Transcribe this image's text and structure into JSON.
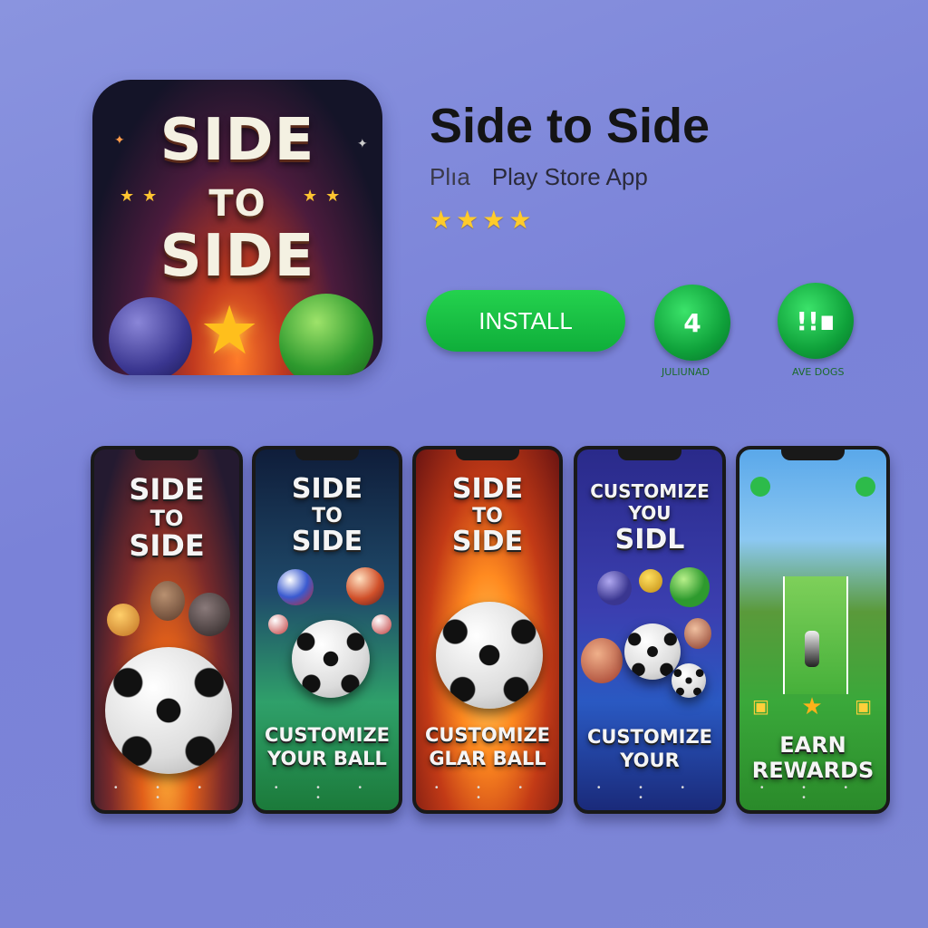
{
  "app": {
    "name": "Side to Side",
    "store_prefix": "Plıa",
    "store_label": "Play Store App",
    "rating_stars": 4,
    "install_label": "INSTALL",
    "badges": [
      {
        "label": "JULIUNAD"
      },
      {
        "label": "AVE DOGS"
      }
    ]
  },
  "icon": {
    "title_line1": "SIDE",
    "title_line2": "TO",
    "title_line3": "SIDE"
  },
  "screenshots": [
    {
      "top": [
        "SIDE",
        "TO",
        "SIDE"
      ],
      "bottom": []
    },
    {
      "top": [
        "SIDE",
        "TO",
        "SIDE"
      ],
      "bottom": [
        "CUSTOMIZE",
        "YOUR BALL"
      ]
    },
    {
      "top": [
        "SIDE",
        "TO",
        "SIDE"
      ],
      "bottom": [
        "CUSTOMIZE",
        "GLAR BALL"
      ]
    },
    {
      "top": [
        "CUSTOMIZE",
        "YOU",
        "SIDL"
      ],
      "bottom": [
        "CUSTOMIZE",
        "YOUR"
      ]
    },
    {
      "top": [],
      "bottom": [
        "EARN",
        "REWARDS"
      ]
    }
  ],
  "colors": {
    "background": "#7f88d9",
    "install": "#1cc346",
    "star": "#ffcb2a"
  }
}
